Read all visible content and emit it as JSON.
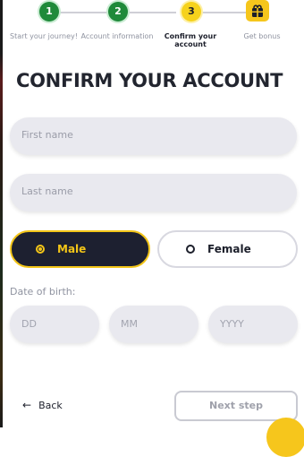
{
  "stepper": {
    "steps": [
      {
        "number": "1",
        "label": "Start your journey!"
      },
      {
        "number": "2",
        "label": "Account information"
      },
      {
        "number": "3",
        "label": "Confirm your account"
      },
      {
        "number": "",
        "label": "Get bonus",
        "icon": "gift-bag-icon"
      }
    ]
  },
  "title": "CONFIRM YOUR ACCOUNT",
  "form": {
    "first_name_placeholder": "First name",
    "last_name_placeholder": "Last name",
    "gender": {
      "male_label": "Male",
      "female_label": "Female",
      "selected": "Male"
    },
    "dob_label": "Date of birth:",
    "dd_placeholder": "DD",
    "mm_placeholder": "MM",
    "yyyy_placeholder": "YYYY"
  },
  "nav": {
    "back_label": "Back",
    "next_label": "Next step"
  },
  "colors": {
    "accent": "#f3c518",
    "done": "#1f8a3a",
    "dark": "#1d2030"
  }
}
